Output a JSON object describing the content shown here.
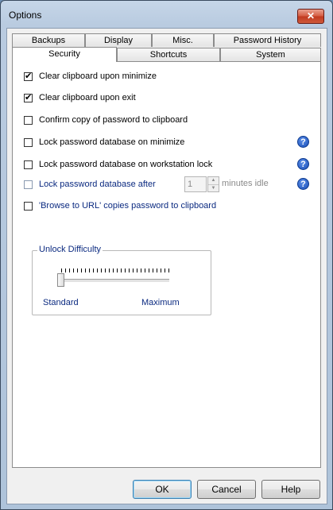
{
  "window": {
    "title": "Options",
    "close_label": "✕"
  },
  "tabs_back": [
    {
      "label": "Backups"
    },
    {
      "label": "Display"
    },
    {
      "label": "Misc."
    },
    {
      "label": "Password History"
    }
  ],
  "tabs_front": [
    {
      "label": "Security",
      "active": true
    },
    {
      "label": "Shortcuts"
    },
    {
      "label": "System"
    }
  ],
  "security": {
    "options": [
      {
        "label": "Clear clipboard upon minimize",
        "checked": true
      },
      {
        "label": "Clear clipboard upon exit",
        "checked": true
      },
      {
        "label": "Confirm copy of password to clipboard",
        "checked": false
      },
      {
        "label": "Lock password database on minimize",
        "checked": false
      },
      {
        "label": "Lock password database on workstation lock",
        "checked": false
      },
      {
        "label": "Lock password database after",
        "checked": false
      },
      {
        "label": "'Browse to URL' copies password to clipboard",
        "checked": false
      }
    ],
    "lock_after_value": "1",
    "minutes_label": "minutes idle",
    "help_glyph": "?",
    "unlock": {
      "legend": "Unlock Difficulty",
      "min_label": "Standard",
      "max_label": "Maximum",
      "level": 0
    }
  },
  "buttons": {
    "ok": "OK",
    "cancel": "Cancel",
    "help": "Help"
  },
  "colors": {
    "label_blue": "#0b2a80",
    "help_blue": "#1a4fb8",
    "close_red": "#c0391e"
  }
}
